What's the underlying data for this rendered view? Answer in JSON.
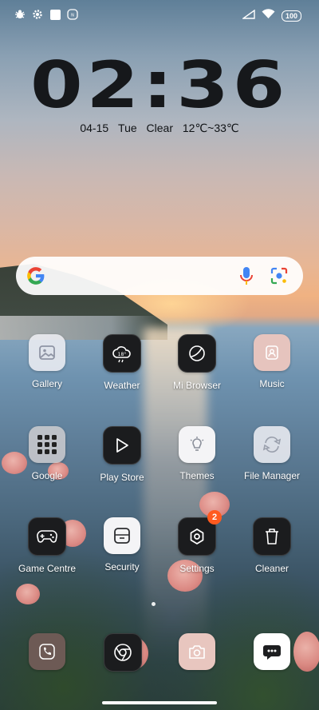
{
  "status_bar": {
    "left_icons": [
      "bug-icon",
      "settings-icon",
      "square-icon",
      "nfc-icon"
    ],
    "right_icons": [
      "signal-icon",
      "wifi-icon"
    ],
    "battery": "100"
  },
  "clock": {
    "time": "02:36",
    "date": "04-15",
    "day": "Tue",
    "weather": "Clear",
    "temp_range": "12℃~33℃"
  },
  "search_bar": {
    "icons": [
      "google-logo",
      "mic-icon",
      "lens-icon"
    ],
    "colors": {
      "blue": "#4285F4",
      "red": "#EA4335",
      "yellow": "#FBBC05",
      "green": "#34A853"
    }
  },
  "apps": [
    {
      "label": "Gallery",
      "icon": "gallery-icon"
    },
    {
      "label": "Weather",
      "icon": "weather-icon"
    },
    {
      "label": "Mi Browser",
      "icon": "browser-icon"
    },
    {
      "label": "Music",
      "icon": "music-icon"
    },
    {
      "label": "Google",
      "icon": "google-folder-icon"
    },
    {
      "label": "Play Store",
      "icon": "play-store-icon"
    },
    {
      "label": "Themes",
      "icon": "themes-icon"
    },
    {
      "label": "File Manager",
      "icon": "file-manager-icon"
    },
    {
      "label": "Game Centre",
      "icon": "gamepad-icon"
    },
    {
      "label": "Security",
      "icon": "security-icon"
    },
    {
      "label": "Settings",
      "icon": "settings-icon",
      "badge": "2"
    },
    {
      "label": "Cleaner",
      "icon": "trash-icon"
    }
  ],
  "dock": [
    {
      "icon": "phone-icon"
    },
    {
      "icon": "chrome-icon"
    },
    {
      "icon": "camera-icon"
    },
    {
      "icon": "messages-icon"
    }
  ]
}
